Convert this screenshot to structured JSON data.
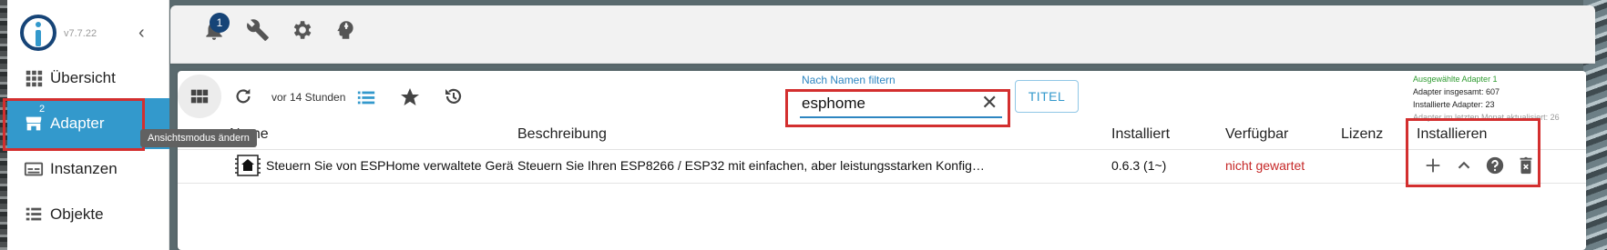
{
  "sidebar": {
    "version": "v7.7.22",
    "items": [
      {
        "label": "Übersicht",
        "icon": "grid-icon"
      },
      {
        "label": "Adapter",
        "icon": "store-icon",
        "badge": "2"
      },
      {
        "label": "Instanzen",
        "icon": "instances-icon"
      },
      {
        "label": "Objekte",
        "icon": "list-icon"
      }
    ],
    "tooltip": "Ansichtsmodus ändern"
  },
  "topbar": {
    "notification_count": "1",
    "icons": [
      "bell-icon",
      "wrench-icon",
      "gear-icon",
      "head-icon"
    ]
  },
  "toolbar": {
    "updated_label": "vor 14 Stunden",
    "filter_label": "Nach Namen filtern",
    "filter_value": "esphome",
    "titel_button": "TITEL"
  },
  "stats": {
    "selected": "Ausgewählte Adapter 1",
    "total": "Adapter insgesamt: 607",
    "installed": "Installierte Adapter: 23",
    "updated": "Adapter im letzten Monat aktualisiert: 26"
  },
  "table": {
    "headers": {
      "name": "Name",
      "description": "Beschreibung",
      "installed": "Installiert",
      "available": "Verfügbar",
      "license": "Lizenz",
      "install": "Installieren"
    },
    "rows": [
      {
        "name": "Steuern Sie von ESPHome verwaltete Geräte",
        "description": "Steuern Sie Ihren ESP8266 / ESP32 mit einfachen, aber leistungsstarken Konfig…",
        "installed": "0.6.3 (1~)",
        "available": "nicht gewartet",
        "license": ""
      }
    ]
  },
  "colors": {
    "accent": "#3399cc",
    "highlight": "#d32f2f",
    "logo": "#164477"
  }
}
